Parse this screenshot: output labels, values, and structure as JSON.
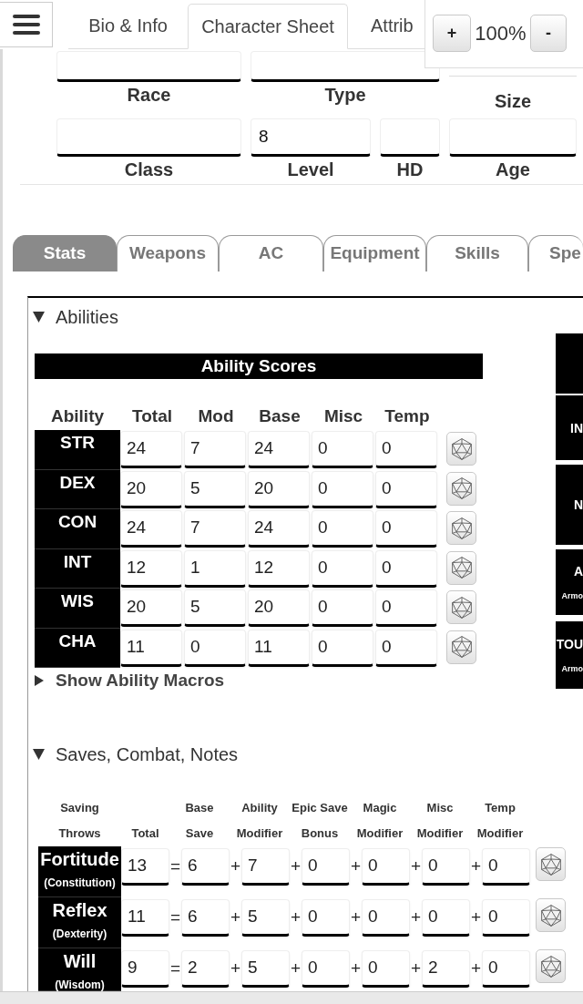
{
  "top_bar": {
    "tabs": [
      {
        "label": "Bio & Info",
        "selected": false
      },
      {
        "label": "Character Sheet",
        "selected": true
      },
      {
        "label": "Attrib",
        "selected": false
      }
    ],
    "zoom": {
      "increase": "+",
      "value": "100%",
      "decrease": "-"
    }
  },
  "header_fields": [
    {
      "label": "Race",
      "kind": "boxed"
    },
    {
      "label": "Type",
      "kind": "boxed"
    },
    {
      "label": "Size",
      "kind": "line"
    },
    {
      "label": "Class",
      "kind": "boxed"
    },
    {
      "label": "Level",
      "kind": "boxed",
      "value": "8"
    },
    {
      "label": "HD",
      "kind": "boxed"
    },
    {
      "label": "Age",
      "kind": "boxed"
    }
  ],
  "sheet_tabs": [
    {
      "label": "Stats",
      "selected": true
    },
    {
      "label": "Weapons",
      "selected": false
    },
    {
      "label": "AC",
      "selected": false
    },
    {
      "label": "Equipment",
      "selected": false
    },
    {
      "label": "Skills",
      "selected": false
    },
    {
      "label": "Spe",
      "selected": false
    }
  ],
  "abilities": {
    "title": "Abilities",
    "expanded": true,
    "table_title": "Ability Scores",
    "columns": [
      "Ability",
      "Total",
      "Mod",
      "Base",
      "Misc",
      "Temp"
    ],
    "rows": [
      {
        "name": "STR",
        "values": [
          "24",
          "7",
          "24",
          "0",
          "0"
        ]
      },
      {
        "name": "DEX",
        "values": [
          "20",
          "5",
          "20",
          "0",
          "0"
        ]
      },
      {
        "name": "CON",
        "values": [
          "24",
          "7",
          "24",
          "0",
          "0"
        ]
      },
      {
        "name": "INT",
        "values": [
          "12",
          "1",
          "12",
          "0",
          "0"
        ]
      },
      {
        "name": "WIS",
        "values": [
          "20",
          "5",
          "20",
          "0",
          "0"
        ]
      },
      {
        "name": "CHA",
        "values": [
          "11",
          "0",
          "11",
          "0",
          "0"
        ]
      }
    ],
    "macros": {
      "label": "Show Ability Macros",
      "expanded": false
    }
  },
  "side_blocks": [
    {
      "kind": "blank"
    },
    {
      "kind": "label",
      "title": "IN"
    },
    {
      "kind": "label",
      "title": "N"
    },
    {
      "kind": "label",
      "title": "A",
      "subtitle": "Armo"
    },
    {
      "kind": "label",
      "title": "TOU",
      "subtitle": "Armo"
    }
  ],
  "saves": {
    "title": "Saves, Combat, Notes",
    "expanded": true,
    "columns": [
      {
        "lines": [
          "Saving",
          "Throws"
        ]
      },
      {
        "lines": [
          "Total"
        ]
      },
      {
        "lines": [
          "Base",
          "Save"
        ]
      },
      {
        "lines": [
          "Ability",
          "Modifier"
        ]
      },
      {
        "lines": [
          "Epic Save",
          "Bonus"
        ]
      },
      {
        "lines": [
          "Magic",
          "Modifier"
        ]
      },
      {
        "lines": [
          "Misc",
          "Modifier"
        ]
      },
      {
        "lines": [
          "Temp",
          "Modifier"
        ]
      }
    ],
    "rows": [
      {
        "name": "Fortitude",
        "ability": "(Constitution)",
        "total": "13",
        "terms": [
          {
            "op": "=",
            "value": "6"
          },
          {
            "op": "+",
            "value": "7"
          },
          {
            "op": "+",
            "value": "0"
          },
          {
            "op": "+",
            "value": "0"
          },
          {
            "op": "+",
            "value": "0"
          },
          {
            "op": "+",
            "value": "0"
          }
        ]
      },
      {
        "name": "Reflex",
        "ability": "(Dexterity)",
        "total": "11",
        "terms": [
          {
            "op": "=",
            "value": "6"
          },
          {
            "op": "+",
            "value": "5"
          },
          {
            "op": "+",
            "value": "0"
          },
          {
            "op": "+",
            "value": "0"
          },
          {
            "op": "+",
            "value": "0"
          },
          {
            "op": "+",
            "value": "0"
          }
        ]
      },
      {
        "name": "Will",
        "ability": "(Wisdom)",
        "total": "9",
        "terms": [
          {
            "op": "=",
            "value": "2"
          },
          {
            "op": "+",
            "value": "5"
          },
          {
            "op": "+",
            "value": "0"
          },
          {
            "op": "+",
            "value": "0"
          },
          {
            "op": "+",
            "value": "2"
          },
          {
            "op": "+",
            "value": "0"
          }
        ]
      }
    ]
  }
}
